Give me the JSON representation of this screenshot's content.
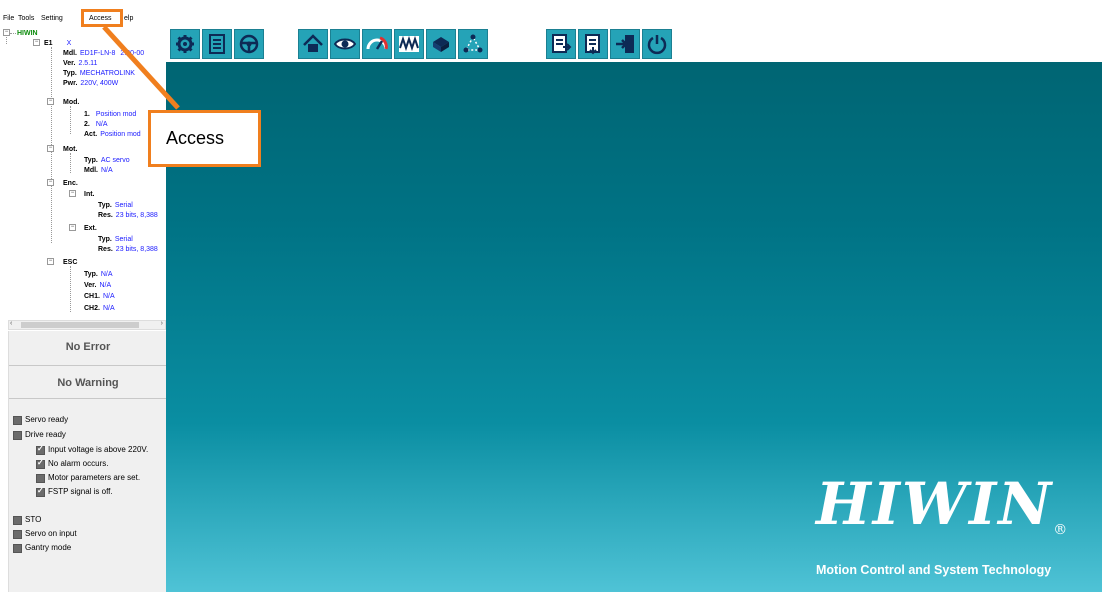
{
  "menu": {
    "items": [
      "File",
      "Tools",
      "Setting",
      "Access",
      "elp"
    ]
  },
  "tree": {
    "root": "HIWIN",
    "axis": {
      "key": "E1",
      "value": "X"
    },
    "rows": [
      {
        "key": "Mdl.",
        "value": "ED1F-LN-8"
      },
      {
        "key": "Ver.",
        "value": "2.5.11"
      },
      {
        "key": "Typ.",
        "value": "MECHATROLINK"
      },
      {
        "key": "Pwr.",
        "value": "220V, 400W"
      },
      {
        "key": "Mod.",
        "value": ""
      },
      {
        "key": "1.",
        "value": "Position mod"
      },
      {
        "key": "2.",
        "value": "N/A"
      },
      {
        "key": "Act.",
        "value": "Position mod"
      },
      {
        "key": "Mot.",
        "value": ""
      },
      {
        "key": "Typ.",
        "value": "AC servo"
      },
      {
        "key": "Mdl.",
        "value": "N/A"
      },
      {
        "key": "Enc.",
        "value": ""
      },
      {
        "key": "Int.",
        "value": ""
      },
      {
        "key": "Typ.",
        "value": "Serial"
      },
      {
        "key": "Res.",
        "value": "23 bits, 8,388"
      },
      {
        "key": "Ext.",
        "value": ""
      },
      {
        "key": "Typ.",
        "value": "Serial"
      },
      {
        "key": "Res.",
        "value": "23 bits, 8,388"
      },
      {
        "key": "ESC",
        "value": ""
      },
      {
        "key": "Typ.",
        "value": "N/A"
      },
      {
        "key": "Ver.",
        "value": "N/A"
      },
      {
        "key": "CH1.",
        "value": "N/A"
      },
      {
        "key": "CH2.",
        "value": "N/A"
      }
    ],
    "mdl_tail": "2.00-00"
  },
  "status": {
    "error": "No Error",
    "warning": "No Warning",
    "checks": [
      {
        "label": "Servo ready",
        "checked": false
      },
      {
        "label": "Drive ready",
        "checked": false
      },
      {
        "label": "Input voltage is above 220V.",
        "checked": true
      },
      {
        "label": "No alarm occurs.",
        "checked": true
      },
      {
        "label": "Motor parameters are set.",
        "checked": false
      },
      {
        "label": "FSTP signal is off.",
        "checked": true
      },
      {
        "label": "STO",
        "checked": false
      },
      {
        "label": "Servo on input",
        "checked": false
      },
      {
        "label": "Gantry mode",
        "checked": false
      }
    ]
  },
  "toolbar": {
    "icons": [
      "wrench-gear-icon",
      "document-list-icon",
      "steering-wheel-icon",
      "home-icon",
      "eye-icon",
      "gauge-icon",
      "waveform-icon",
      "motor-icon",
      "nodes-icon",
      "document-export-icon",
      "document-import-icon",
      "exit-door-icon",
      "power-restart-icon"
    ]
  },
  "callout": {
    "text": "Access"
  },
  "logo": {
    "word": "HIWIN",
    "reg": "®",
    "tagline": "Motion Control and System Technology"
  },
  "colors": {
    "accent": "#f07f1e",
    "teal_dark": "#00626f",
    "teal_light": "#4fc3d6",
    "button": "#25a3b7",
    "tree_value": "#1a1aff"
  }
}
